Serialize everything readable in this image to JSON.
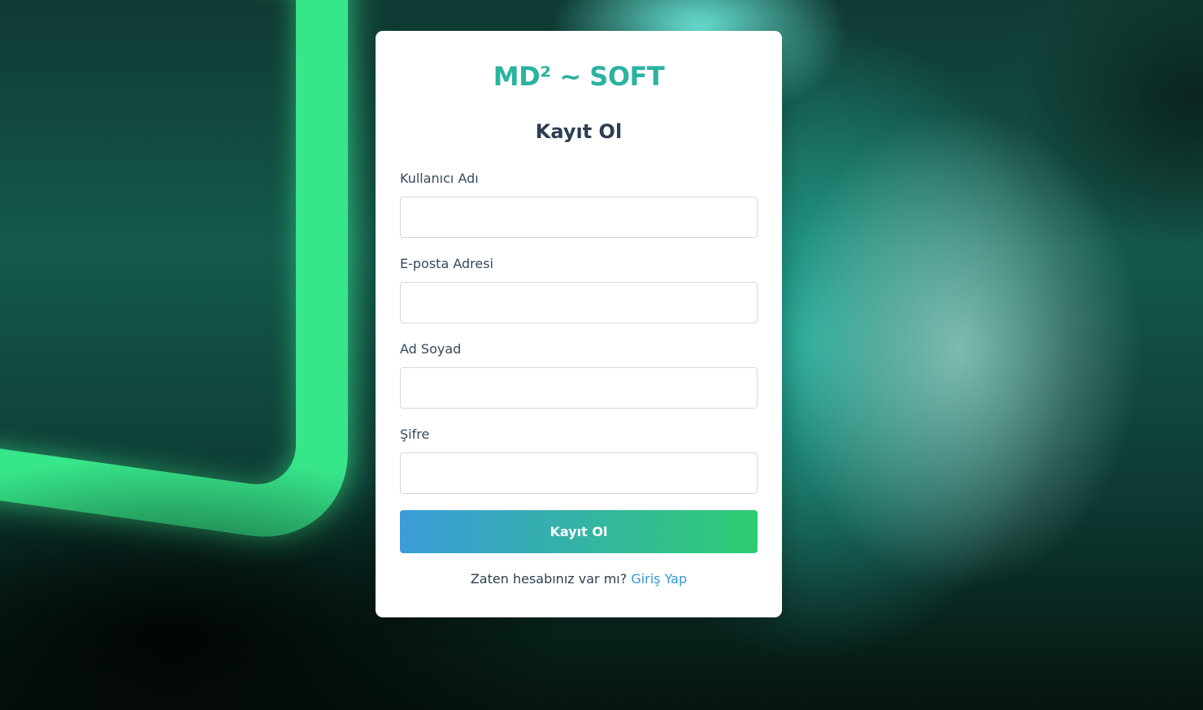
{
  "brand": "MD² ~ SOFT",
  "form": {
    "title": "Kayıt Ol",
    "fields": [
      {
        "label": "Kullanıcı Adı",
        "value": "",
        "placeholder": ""
      },
      {
        "label": "E-posta Adresi",
        "value": "",
        "placeholder": ""
      },
      {
        "label": "Ad Soyad",
        "value": "",
        "placeholder": ""
      },
      {
        "label": "Şifre",
        "value": "",
        "placeholder": ""
      }
    ],
    "submit_label": "Kayıt Ol"
  },
  "footer": {
    "prompt": "Zaten hesabınız var mı?",
    "link_label": "Giriş Yap"
  },
  "colors": {
    "brand": "#2bb3a0",
    "button_gradient_start": "#3a9bd9",
    "button_gradient_end": "#2ecc71",
    "link": "#3498db"
  }
}
